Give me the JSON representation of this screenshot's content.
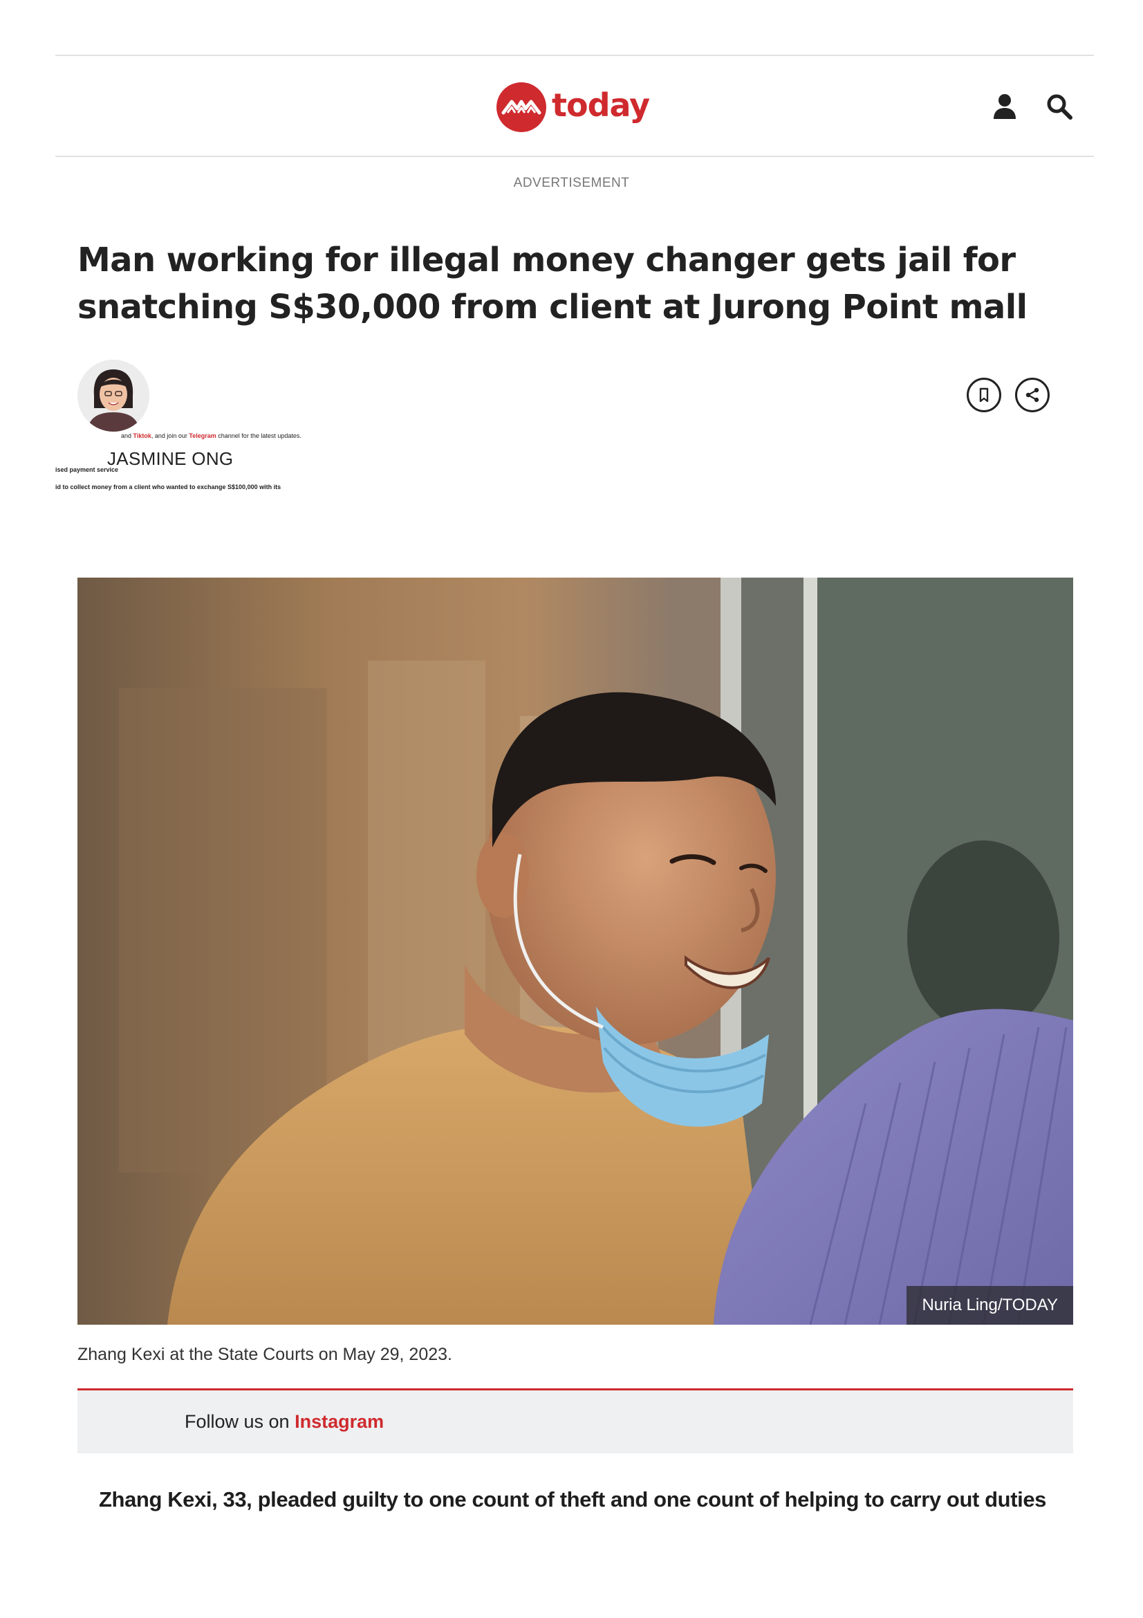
{
  "header": {
    "logo_text": "today",
    "brand_color": "#cf2a2e",
    "icons": [
      "user-icon",
      "search-icon"
    ]
  },
  "ad_label": "ADVERTISEMENT",
  "article": {
    "headline": "Man working for illegal money changer gets jail for snatching S$30,000 from client at Jurong Point mall",
    "author": "JASMINE ONG",
    "tiny_lines": {
      "line1_prefix": "and ",
      "line1_tiktok": "Tiktok",
      "line1_mid": ", and join our ",
      "line1_telegram": "Telegram",
      "line1_suffix": " channel for the latest updates.",
      "line2": "ised payment service",
      "line3": "id to collect money from a client who wanted to exchange S$100,000 with its"
    },
    "actions": [
      "bookmark-icon",
      "share-icon"
    ],
    "image": {
      "credit": "Nuria Ling/TODAY",
      "caption": "Zhang Kexi at the State Courts on May 29, 2023."
    },
    "follow": {
      "prefix": "Follow us on ",
      "link": "Instagram"
    },
    "lede": "Zhang Kexi, 33, pleaded guilty to one count of theft and one count of helping to carry out duties"
  }
}
